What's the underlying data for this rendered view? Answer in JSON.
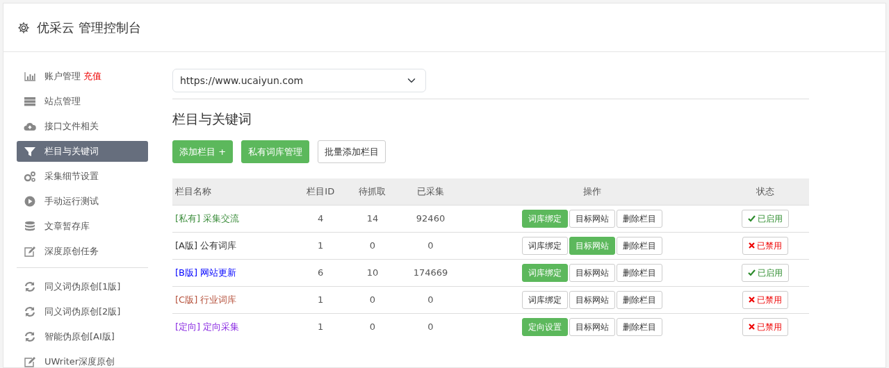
{
  "header": {
    "title": "优采云 管理控制台"
  },
  "sidebar": {
    "groups": [
      {
        "items": [
          {
            "label": "账户管理",
            "tag": "充值",
            "selected": false
          },
          {
            "label": "站点管理",
            "selected": false
          },
          {
            "label": "接口文件相关",
            "selected": false
          },
          {
            "label": "栏目与关键词",
            "selected": true
          },
          {
            "label": "采集细节设置",
            "selected": false
          },
          {
            "label": "手动运行测试",
            "selected": false
          },
          {
            "label": "文章暂存库",
            "selected": false
          },
          {
            "label": "深度原创任务",
            "selected": false
          }
        ]
      },
      {
        "items": [
          {
            "label": "同义词伪原创[1版]",
            "selected": false
          },
          {
            "label": "同义词伪原创[2版]",
            "selected": false
          },
          {
            "label": "智能伪原创[AI版]",
            "selected": false
          },
          {
            "label": "UWriter深度原创",
            "selected": false
          }
        ]
      }
    ]
  },
  "site_select": {
    "value": "https://www.ucaiyun.com"
  },
  "section_title": "栏目与关键词",
  "toolbar": [
    {
      "label": "添加栏目 +",
      "primary": true
    },
    {
      "label": "私有词库管理",
      "primary": true
    },
    {
      "label": "批量添加栏目",
      "primary": false
    }
  ],
  "table": {
    "columns": [
      "栏目名称",
      "栏目ID",
      "待抓取",
      "已采集",
      "操作",
      "状态"
    ],
    "rows": [
      {
        "tag": "[私有]",
        "name": "采集交流",
        "color": "#3c8d3c",
        "id": "4",
        "pending": "14",
        "collected": "92460",
        "actions": [
          {
            "label": "词库绑定",
            "primary": true
          },
          {
            "label": "目标网站",
            "primary": false
          },
          {
            "label": "删除栏目",
            "primary": false
          }
        ],
        "status": {
          "label": "已启用",
          "enabled": true
        }
      },
      {
        "tag": "[A版]",
        "name": "公有词库",
        "color": "#333333",
        "id": "1",
        "pending": "0",
        "collected": "0",
        "actions": [
          {
            "label": "词库绑定",
            "primary": false
          },
          {
            "label": "目标网站",
            "primary": true
          },
          {
            "label": "删除栏目",
            "primary": false
          }
        ],
        "status": {
          "label": "已禁用",
          "enabled": false
        }
      },
      {
        "tag": "[B版]",
        "name": "网站更新",
        "color": "#0000ff",
        "id": "6",
        "pending": "10",
        "collected": "174669",
        "actions": [
          {
            "label": "词库绑定",
            "primary": true
          },
          {
            "label": "目标网站",
            "primary": false
          },
          {
            "label": "删除栏目",
            "primary": false
          }
        ],
        "status": {
          "label": "已启用",
          "enabled": true
        }
      },
      {
        "tag": "[C版]",
        "name": "行业词库",
        "color": "#b5503a",
        "id": "1",
        "pending": "0",
        "collected": "0",
        "actions": [
          {
            "label": "词库绑定",
            "primary": false
          },
          {
            "label": "目标网站",
            "primary": false
          },
          {
            "label": "删除栏目",
            "primary": false
          }
        ],
        "status": {
          "label": "已禁用",
          "enabled": false
        }
      },
      {
        "tag": "[定向]",
        "name": "定向采集",
        "color": "#8a2be2",
        "id": "1",
        "pending": "0",
        "collected": "0",
        "actions": [
          {
            "label": "定向设置",
            "primary": true
          },
          {
            "label": "目标网站",
            "primary": false
          },
          {
            "label": "删除栏目",
            "primary": false
          }
        ],
        "status": {
          "label": "已禁用",
          "enabled": false
        }
      }
    ]
  }
}
